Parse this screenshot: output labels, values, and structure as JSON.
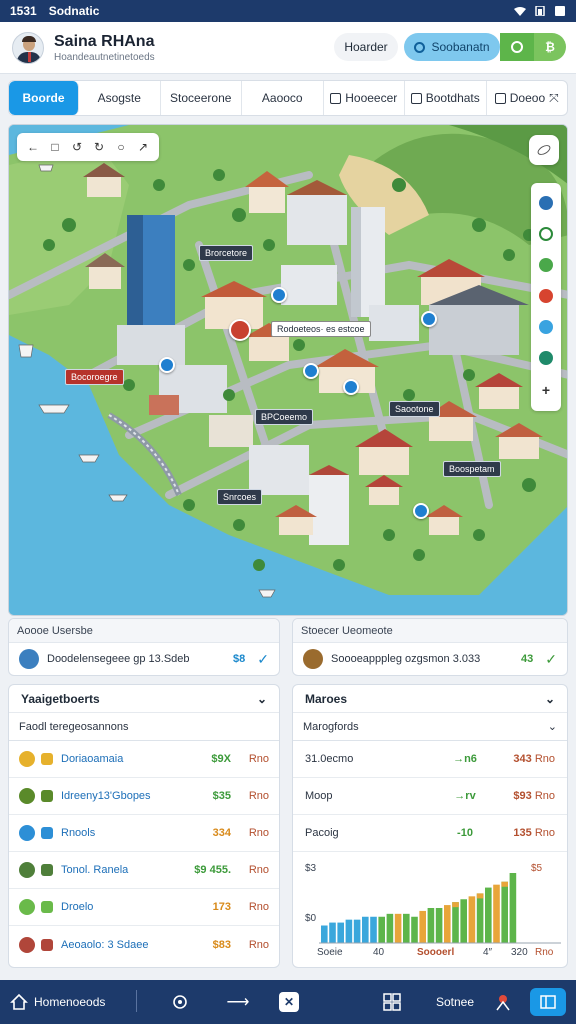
{
  "status_bar": {
    "time": "1531",
    "carrier": "Sodnatic"
  },
  "header": {
    "user_name": "Saina RHAna",
    "user_subtitle": "Hoandeautnetinetoeds",
    "plain_button": "Hoarder",
    "primary_button": "Soobanatn",
    "extra_button": "₿"
  },
  "tabs": [
    {
      "label": "Boorde",
      "active": true
    },
    {
      "label": "Asogste"
    },
    {
      "label": "Stoceerone"
    },
    {
      "label": "Aaooco"
    },
    {
      "label": "Hooeecer"
    },
    {
      "label": "Bootdhats"
    },
    {
      "label": "Doeoo"
    }
  ],
  "map": {
    "toolbar": [
      "←",
      "□",
      "↺",
      "↻",
      "○",
      "↗"
    ],
    "labels": [
      {
        "text": "Brorcetore",
        "style": "dark"
      },
      {
        "text": "Rodoeteos· es estcoe",
        "style": "white"
      },
      {
        "text": "Bocoroegre",
        "style": "red"
      },
      {
        "text": "BPCoeemo",
        "style": "dark"
      },
      {
        "text": "Saootone",
        "style": "dark"
      },
      {
        "text": "Boospetam",
        "style": "dark"
      },
      {
        "text": "Snrcoes",
        "style": "dark"
      }
    ],
    "side_tools": [
      "building-icon",
      "route-icon",
      "weather-icon",
      "alert-icon",
      "layers-icon",
      "transit-icon",
      "zoom-icon"
    ]
  },
  "info_left": {
    "title": "Aoooe Usersbe",
    "text": "Doodelensegeee gp 13.Sdeb",
    "value": "$8"
  },
  "info_right": {
    "title": "Stoecer Ueomeote",
    "text": "Soooeapppleg ozgsmon 3.033",
    "value": "43"
  },
  "list_left": {
    "title": "Yaaigetboerts",
    "subtitle": "Faodl teregeosannons",
    "rows": [
      {
        "name": "Doriaoamaia",
        "amount": "$9X",
        "unit": "Rno",
        "amount_color": "green",
        "dot": "#e6b12c"
      },
      {
        "name": "Idreeny13'Gbopes",
        "amount": "$35",
        "unit": "Rno",
        "amount_color": "green",
        "dot": "#5a8a2a"
      },
      {
        "name": "Rnools",
        "amount": "334",
        "unit": "Rno",
        "amount_color": "orange",
        "dot": "#2d8fd6"
      },
      {
        "name": "Tonol. Ranela",
        "amount": "$9 455.",
        "unit": "Rno",
        "amount_color": "green",
        "dot": "#4f7f3a"
      },
      {
        "name": "Droelo",
        "amount": "173",
        "unit": "Rno",
        "amount_color": "orange",
        "dot": "#6aba4a"
      },
      {
        "name": "Aeoaolo: 3 Sdaee",
        "amount": "$83",
        "unit": "Rno",
        "amount_color": "orange",
        "dot": "#b0463a"
      }
    ]
  },
  "list_right": {
    "title": "Maroes",
    "subtitle": "Marogfords",
    "rows": [
      {
        "key": "31.0ecmo",
        "value": "→n6",
        "right": "343",
        "unit": "Rno"
      },
      {
        "key": "Moop",
        "value": "→rv",
        "right": "$93",
        "unit": "Rno"
      },
      {
        "key": "Pacoig",
        "value": "-10",
        "right": "135",
        "unit": "Rno"
      }
    ],
    "chart_labels": {
      "y_top": "$3",
      "y_bottom": "$0",
      "right_top": "$5",
      "x_left": "Soeie",
      "x_mid": "40",
      "x_mid2": "Soooerl",
      "x_right": "4″",
      "x_far": "320",
      "x_unit": "Rno"
    }
  },
  "chart_data": {
    "type": "bar",
    "categories": [
      "1",
      "2",
      "3",
      "4",
      "5",
      "6",
      "7",
      "8",
      "9",
      "10",
      "11",
      "12",
      "13",
      "14",
      "15",
      "16",
      "17",
      "18",
      "19",
      "20",
      "21",
      "22",
      "23",
      "24"
    ],
    "series": [
      {
        "values": [
          6,
          7,
          7,
          8,
          8,
          9,
          9,
          9,
          10,
          10,
          10,
          9,
          11,
          12,
          12,
          13,
          14,
          15,
          16,
          17,
          19,
          20,
          21,
          24
        ]
      }
    ]
  },
  "bottom_bar": {
    "home_label": "Homenoeods",
    "right_label": "Sotnee"
  }
}
